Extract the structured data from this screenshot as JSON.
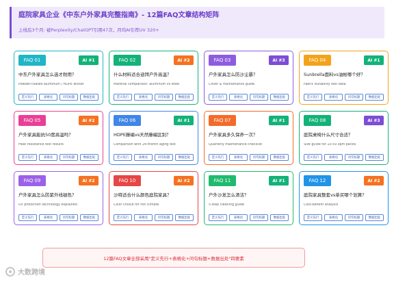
{
  "header": {
    "title": "庭院家具企业《中东户外家具完整指南》- 12篇FAQ文章结构矩阵",
    "subtitle": "上线后3个月: 被Perplexity/ChatGPT引用47次，月均AI引荐UV 320+"
  },
  "colors": {
    "ai1": "#13b279",
    "ai2": "#f57221",
    "ai3": "#7d4dd6",
    "card_faq": [
      "#1fb6c6",
      "#13b279",
      "#8d5ce0",
      "#f3a31a",
      "#ea3f96",
      "#3f86e8",
      "#f36b2b",
      "#13b279",
      "#9b61e8",
      "#e64646",
      "#20ba6f",
      "#1f94e8"
    ],
    "card_border": [
      "#1fb6c6",
      "#13b279",
      "#8d5ce0",
      "#f3a31a",
      "#ea3f96",
      "#3f86e8",
      "#f36b2b",
      "#13b279",
      "#9b61e8",
      "#e64646",
      "#20ba6f",
      "#1f94e8"
    ]
  },
  "tag_labels": [
    "定义先行",
    "表格化",
    "问句标题",
    "数据出处"
  ],
  "cards": [
    {
      "faq": "FAQ 01",
      "ai": "AI #1",
      "ai_level": 1,
      "question": "中东户外家具怎么选才耐用？",
      "detail": "Powder-coated aluminum / HDPE wicker",
      "tags": [
        "定义先行",
        "表格化",
        "问句标题",
        "数据出处"
      ]
    },
    {
      "faq": "FAQ 02",
      "ai": "AI #2",
      "ai_level": 2,
      "question": "什么材料适合迪拜户外高温？",
      "detail": "Material comparison: aluminum vs steel",
      "tags": [
        "定义先行",
        "表格化",
        "问句标题",
        "数据出处"
      ]
    },
    {
      "faq": "FAQ 03",
      "ai": "AI #3",
      "ai_level": 3,
      "question": "户外家具怎么防沙尘暴？",
      "detail": "Cover & maintenance guide",
      "tags": [
        "定义先行",
        "表格化",
        "问句标题",
        "数据出处"
      ]
    },
    {
      "faq": "FAQ 04",
      "ai": "AI #1",
      "ai_level": 1,
      "question": "Sunbrella面料vs油帐哪个好？",
      "detail": "Fabric durability test data",
      "tags": [
        "定义先行",
        "表格化",
        "问句标题",
        "数据出处"
      ]
    },
    {
      "faq": "FAQ 05",
      "ai": "AI #2",
      "ai_level": 2,
      "question": "户外家具能抗50度高温吗？",
      "detail": "Heat resistance test results",
      "tags": [
        "定义先行",
        "表格化",
        "问句标题",
        "数据出处"
      ]
    },
    {
      "faq": "FAQ 06",
      "ai": "AI #1",
      "ai_level": 1,
      "question": "HDPE藤编vs天然藤编区别？",
      "detail": "Comparison with 24-month aging test",
      "tags": [
        "定义先行",
        "表格化",
        "问句标题",
        "数据出处"
      ]
    },
    {
      "faq": "FAQ 07",
      "ai": "AI #1",
      "ai_level": 1,
      "question": "户外家具多久保养一次？",
      "detail": "Quarterly maintenance checklist",
      "tags": [
        "定义先行",
        "表格化",
        "问句标题",
        "数据出处"
      ]
    },
    {
      "faq": "FAQ 08",
      "ai": "AI #3",
      "ai_level": 3,
      "question": "庭院桌椅什么尺寸合适？",
      "detail": "Size guide for 10-50 sqm patios",
      "tags": [
        "定义先行",
        "表格化",
        "问句标题",
        "数据出处"
      ]
    },
    {
      "faq": "FAQ 09",
      "ai": "AI #2",
      "ai_level": 2,
      "question": "户外家具怎么防紫外线褪色？",
      "detail": "UV protection technology explained",
      "tags": [
        "定义先行",
        "表格化",
        "问句标题",
        "数据出处"
      ]
    },
    {
      "faq": "FAQ 10",
      "ai": "AI #2",
      "ai_level": 2,
      "question": "沙特适合什么颜色庭院家具？",
      "detail": "Color choice for hot climate",
      "tags": [
        "定义先行",
        "表格化",
        "问句标题",
        "数据出处"
      ]
    },
    {
      "faq": "FAQ 11",
      "ai": "AI #1",
      "ai_level": 1,
      "question": "户外沙发怎么清洁？",
      "detail": "5-step cleaning guide",
      "tags": [
        "定义先行",
        "表格化",
        "问句标题",
        "数据出处"
      ]
    },
    {
      "faq": "FAQ 12",
      "ai": "AI #2",
      "ai_level": 2,
      "question": "庭院家具整套vs单买哪个划算？",
      "detail": "Cost-benefit analysis",
      "tags": [
        "定义先行",
        "表格化",
        "问句标题",
        "数据出处"
      ]
    }
  ],
  "footer": {
    "text": "12篇FAQ文章全部采用\"定义先行+表格化+问句标题+数据出处\"四要素"
  },
  "watermark": {
    "text": "大数跨境",
    "icon": "brand-logo-icon"
  }
}
